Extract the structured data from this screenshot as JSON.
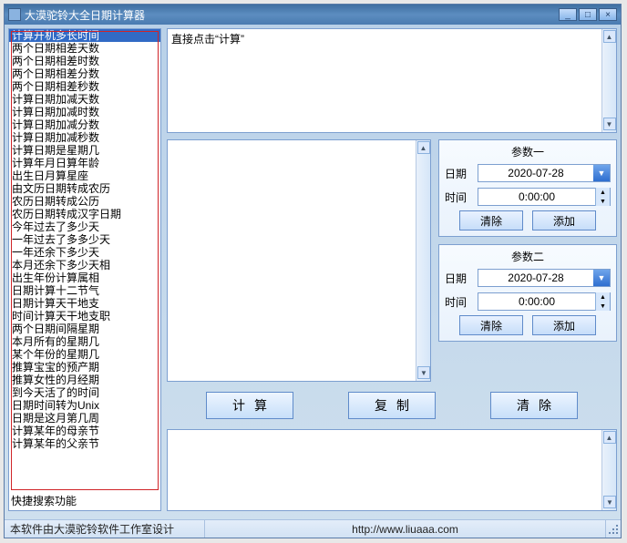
{
  "window": {
    "title": "大漠驼铃大全日期计算器",
    "min": "_",
    "max": "□",
    "close": "×"
  },
  "sidebar": {
    "items": [
      "计算开机多长时间",
      "两个日期相差天数",
      "两个日期相差时数",
      "两个日期相差分数",
      "两个日期相差秒数",
      "计算日期加减天数",
      "计算日期加减时数",
      "计算日期加减分数",
      "计算日期加减秒数",
      "计算日期是星期几",
      "计算年月日算年龄",
      "出生日月算星座",
      "由文历日期转成农历",
      "农历日期转成公历",
      "农历日期转成汉字日期",
      "今年过去了多少天",
      "一年过去了多多少天",
      "一年还余下多少天",
      "本月还余下多少天相",
      "出生年份计算属相",
      "日期计算十二节气",
      "日期计算天干地支",
      "时间计算天干地支职",
      "两个日期间隔星期",
      "本月所有的星期几",
      "某个年份的星期几",
      "推算宝宝的预产期",
      "推算女性的月经期",
      "到今天活了的时间",
      "日期时间转为Unix",
      "日期是这月第几周",
      "计算某年的母亲节",
      "计算某年的父亲节"
    ],
    "selected_index": 0,
    "footer": "快捷搜索功能"
  },
  "instruction": {
    "text": "直接点击“计算”"
  },
  "params": [
    {
      "title": "参数一",
      "date_label": "日期",
      "date_value": "2020-07-28",
      "time_label": "时间",
      "time_value": "0:00:00",
      "clear": "清除",
      "add": "添加"
    },
    {
      "title": "参数二",
      "date_label": "日期",
      "date_value": "2020-07-28",
      "time_label": "时间",
      "time_value": "0:00:00",
      "clear": "清除",
      "add": "添加"
    }
  ],
  "buttons": {
    "calc": "计算",
    "copy": "复制",
    "clear": "清除"
  },
  "status": {
    "credit": "本软件由大漠驼铃软件工作室设计",
    "url": "http://www.liuaaa.com"
  }
}
